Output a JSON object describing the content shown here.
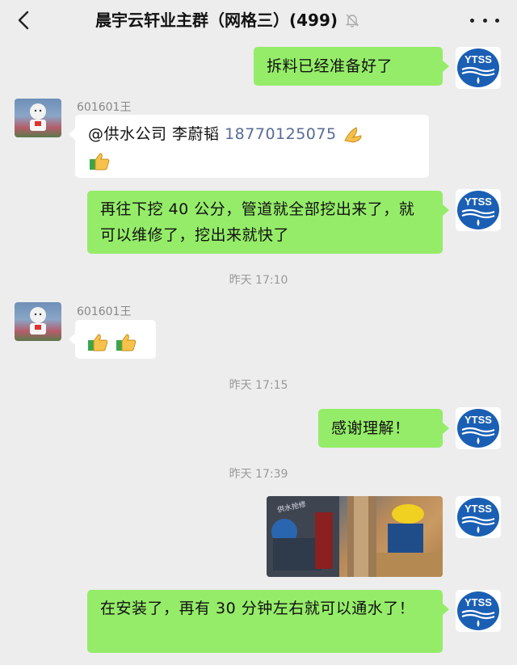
{
  "header": {
    "title": "晨宇云轩业主群（网格三）(499)"
  },
  "messages": {
    "m1": {
      "text": "拆料已经准备好了"
    },
    "m2": {
      "sender": "601601王",
      "text_prefix": "@供水公司 李蔚韬 ",
      "phone": "18770125075"
    },
    "m3": {
      "text": "再往下挖 40 公分，管道就全部挖出来了，就可以维修了，挖出来就快了"
    },
    "ts1": "昨天 17:10",
    "m4": {
      "sender": "601601王"
    },
    "ts2": "昨天 17:15",
    "m5": {
      "text": "感谢理解！"
    },
    "ts3": "昨天 17:39",
    "m6": {
      "photo_alt": "pipe repair photo",
      "photo_text": "供水抢修"
    },
    "m7": {
      "text": "在安装了，再有 30 分钟左右就可以通水了！"
    }
  },
  "avatar_logo": {
    "text": "YTSS"
  },
  "colors": {
    "background": "#ededed",
    "self_bubble": "#95ec69",
    "other_bubble": "#ffffff",
    "link": "#576b95",
    "logo_blue": "#1a5fb4"
  }
}
